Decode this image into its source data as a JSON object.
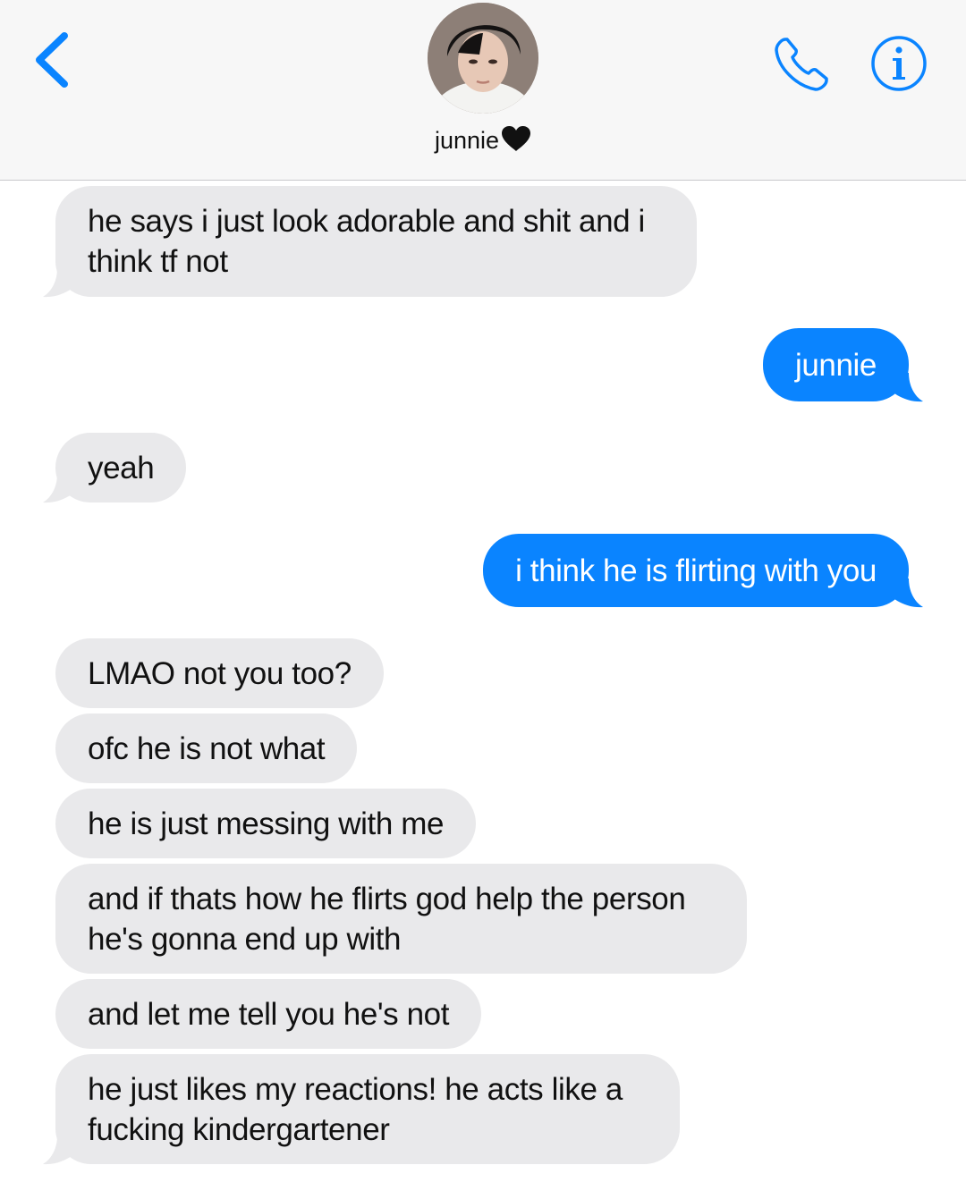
{
  "header": {
    "contact_name": "junnie",
    "back_icon": "chevron-left-icon",
    "call_icon": "phone-icon",
    "info_icon": "info-icon",
    "accent_color": "#0a84ff"
  },
  "messages": [
    {
      "from": "them",
      "text": "he says i just look adorable and shit and i think tf not"
    },
    {
      "from": "me",
      "text": "junnie"
    },
    {
      "from": "them",
      "text": "yeah"
    },
    {
      "from": "me",
      "text": "i think he is flirting with you"
    },
    {
      "from": "them",
      "text": "LMAO not you too?"
    },
    {
      "from": "them",
      "text": "ofc he is not what"
    },
    {
      "from": "them",
      "text": "he is just messing with me"
    },
    {
      "from": "them",
      "text": "and if thats how he flirts god help the person he's gonna end up with"
    },
    {
      "from": "them",
      "text": "and let me tell you he's not"
    },
    {
      "from": "them",
      "text": "he just likes my reactions! he acts like a fucking kindergartener"
    }
  ],
  "colors": {
    "received_bubble": "#e9e9eb",
    "sent_bubble": "#0a84ff"
  }
}
